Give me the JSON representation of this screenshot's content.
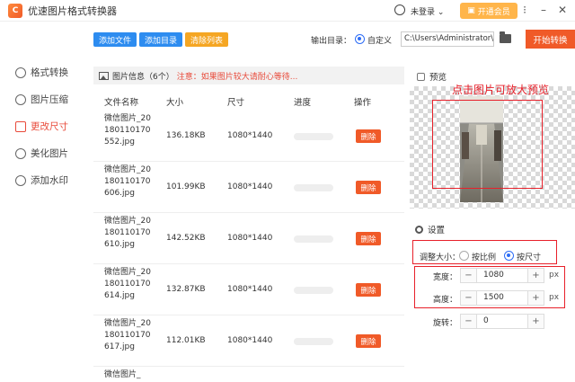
{
  "app": {
    "title": "优速图片格式转换器"
  },
  "titlebar": {
    "login": "未登录",
    "vip": "开通会员",
    "menu_glyph": "⁝",
    "minimize_glyph": "–",
    "close_glyph": "✕",
    "logo_glyph": "C"
  },
  "sidebar": {
    "items": [
      {
        "label": "格式转换",
        "icon": "convert-icon"
      },
      {
        "label": "图片压缩",
        "icon": "compress-icon"
      },
      {
        "label": "更改尺寸",
        "icon": "resize-icon"
      },
      {
        "label": "美化图片",
        "icon": "beautify-icon"
      },
      {
        "label": "添加水印",
        "icon": "watermark-icon"
      }
    ],
    "active_index": 2
  },
  "toolbar": {
    "add_file": "添加文件",
    "add_dir": "添加目录",
    "clear_list": "清除列表",
    "output_label": "输出目录：",
    "custom_option": "自定义",
    "output_path": "C:\\Users\\Administrator\\",
    "start": "开始转换"
  },
  "info": {
    "title": "图片信息（6个）",
    "notice": "注意：如果图片较大请耐心等待..."
  },
  "table": {
    "headers": [
      "文件名称",
      "大小",
      "尺寸",
      "进度",
      "操作"
    ],
    "delete_label": "删除",
    "rows": [
      {
        "name": "微信图片_20180110170552.jpg",
        "size": "136.18KB",
        "dims": "1080*1440",
        "progress": 0
      },
      {
        "name": "微信图片_20180110170606.jpg",
        "size": "101.99KB",
        "dims": "1080*1440",
        "progress": 0
      },
      {
        "name": "微信图片_20180110170610.jpg",
        "size": "142.52KB",
        "dims": "1080*1440",
        "progress": 0
      },
      {
        "name": "微信图片_20180110170614.jpg",
        "size": "132.87KB",
        "dims": "1080*1440",
        "progress": 0
      },
      {
        "name": "微信图片_20180110170617.jpg",
        "size": "112.01KB",
        "dims": "1080*1440",
        "progress": 0
      },
      {
        "name": "微信图片_",
        "size": "",
        "dims": "",
        "progress": 0
      }
    ]
  },
  "preview": {
    "title": "预览",
    "hint": "点击图片可放大预览"
  },
  "settings": {
    "title": "设置",
    "resize_label": "调整大小：",
    "by_ratio": "按比例",
    "by_size": "按尺寸",
    "width_label": "宽度：",
    "width_value": "1080",
    "height_label": "高度：",
    "height_value": "1500",
    "rotate_label": "旋转：",
    "rotate_value": "0",
    "unit": "px",
    "minus_glyph": "−",
    "plus_glyph": "+"
  },
  "colors": {
    "accent": "#f05a28",
    "blue": "#2d6df6",
    "annotation_red": "#e8202a"
  }
}
